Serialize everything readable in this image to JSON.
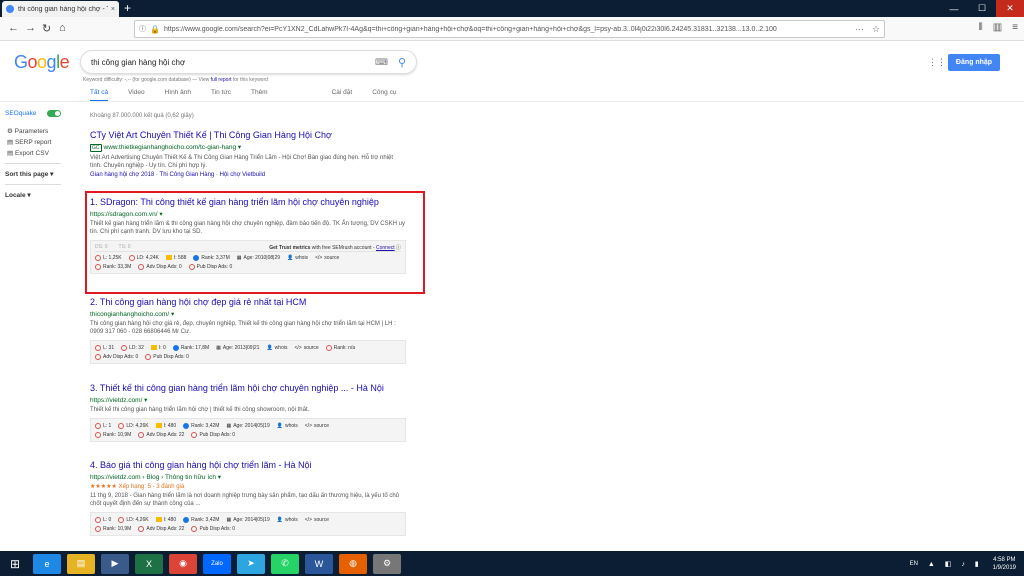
{
  "browser": {
    "tab_title": "thi công gian hàng hội chợ - T",
    "tab_close": "×",
    "new_tab": "+",
    "url": "https://www.google.com/search?ei=PcY1XN2_CdLahwPk7I-4Ag&q=thi+công+gian+hàng+hội+chợ&oq=thi+công+gian+hàng+hội+chợ&gs_l=psy-ab.3..0l4j0i22i30l6.24245.31831..32138...13.0..2.100",
    "win_min": "—",
    "win_max": "☐",
    "win_close": "✕"
  },
  "google": {
    "logo_letters": [
      "G",
      "o",
      "o",
      "g",
      "l",
      "e"
    ],
    "query": "thi công gian hàng hội chợ",
    "signin_label": "Đăng nhập",
    "kw_prefix": "Keyword difficulty: -,-- (for google.com database) — View",
    "kw_link": "full report",
    "kw_suffix": "for this keyword",
    "tabs": [
      "Tất cả",
      "Video",
      "Hình ảnh",
      "Tin tức",
      "Thêm"
    ],
    "tabs_right": [
      "Cài đặt",
      "Công cụ"
    ],
    "stats": "Khoảng 87.000.000 kết quả (0,62 giây)"
  },
  "seoquake": {
    "title": "SEOquake",
    "items": [
      "Parameters",
      "SERP report",
      "Export CSV"
    ],
    "sort_label": "Sort this page",
    "locale_label": "Locale"
  },
  "results": [
    {
      "title": "CTy Việt Art Chuyên Thiết Kế | Thi Công Gian Hàng Hội Chợ",
      "url_badge": "GC",
      "url": "www.thietkegianhanghoicho.com/tc-gian-hang",
      "snippet": "Việt Art Advertising Chuyên Thiết Kế & Thi Công Gian Hàng Triển Lãm - Hội Chợ! Bàn giao đúng hẹn. Hỗ trợ nhiệt tình. Chuyên nghiệp - Uy tín. Chi phí hợp lý.",
      "sitelinks": "Gian hàng hội chợ 2018 · Thi Công Gian Hàng · Hội chợ Vietbuild"
    },
    {
      "title": "1. SDragon: Thi công thiết kế gian hàng triển lãm hội chợ chuyên nghiệp",
      "url": "https://sdragon.com.vn/ ▾",
      "snippet": "Thiết kế gian hàng triển lãm & thi công gian hàng hội chợ chuyên nghiệp, đảm bảo tiến độ. TK Ấn tượng, DV CSKH uy tín. Chi phí cạnh tranh. DV lưu kho tại SD.",
      "trust": {
        "ds": "DS: 0",
        "ts": "TS: 0",
        "text": "Get Trust metrics",
        "text2": "with free SEMrush account -",
        "link": "Connect"
      },
      "row1": [
        [
          "ring",
          "L: 1,25K"
        ],
        [
          "ring",
          "LD: 4,24K"
        ],
        [
          "bar",
          "I: 588"
        ],
        [
          "blue",
          "Rank: 3,37M"
        ],
        [
          "cal",
          "Age: 2010|08|29"
        ],
        [
          "user",
          "whois"
        ],
        [
          "code",
          "source"
        ]
      ],
      "row2": [
        [
          "ring",
          "Rank: 33,3M"
        ],
        [
          "ring",
          "Adv Disp Ads: 0"
        ],
        [
          "ring",
          "Pub Disp Ads: 0"
        ]
      ]
    },
    {
      "title": "2. Thi công gian hàng hội chợ đẹp giá rẻ nhất tại HCM",
      "url": "thicongianhanghoicho.com/ ▾",
      "snippet": "Thi công gian hàng hội chợ giá rẻ, đẹp, chuyên nghiệp, Thiết kế thi công gian hàng hội chợ triển lãm tại HCM | LH : 0909 317 060 - 028 66806446 Mr Cư.",
      "row1": [
        [
          "ring",
          "L: 31"
        ],
        [
          "ring",
          "LD: 32"
        ],
        [
          "bar",
          "I: 0"
        ],
        [
          "blue",
          "Rank: 17,8M"
        ],
        [
          "cal",
          "Age: 2013|09|21"
        ],
        [
          "user",
          "whois"
        ],
        [
          "code",
          "source"
        ],
        [
          "ring",
          "Rank: n/a"
        ]
      ],
      "row2": [
        [
          "ring",
          "Adv Disp Ads: 0"
        ],
        [
          "ring",
          "Pub Disp Ads: 0"
        ]
      ]
    },
    {
      "title": "3. Thiết kế thi công gian hàng triển lãm hội chợ chuyên nghiệp ... - Hà Nội",
      "url": "https://vietdz.com/ ▾",
      "snippet": "Thiết kế thi công gian hàng triển lãm hội chợ | thiết kế thi công showroom, nội thất.",
      "row1": [
        [
          "ring",
          "L: 1"
        ],
        [
          "ring",
          "LD: 4,26K"
        ],
        [
          "bar",
          "I: 480"
        ],
        [
          "blue",
          "Rank: 3,42M"
        ],
        [
          "cal",
          "Age: 2014|05|19"
        ],
        [
          "user",
          "whois"
        ],
        [
          "code",
          "source"
        ]
      ],
      "row2": [
        [
          "ring",
          "Rank: 10,9M"
        ],
        [
          "ring",
          "Adv Disp Ads: 22"
        ],
        [
          "ring",
          "Pub Disp Ads: 0"
        ]
      ]
    },
    {
      "title": "4. Báo giá thi công gian hàng hội chợ triển lãm - Hà Nội",
      "url": "https://vietdz.com › Blog › Thông tin hữu ích ▾",
      "rating": "★★★★★ Xếp hạng: 5 - 3 đánh giá",
      "snippet": "11 thg 9, 2018 - Gian hàng triển lãm là nơi doanh nghiệp trưng bày sản phẩm, tạo dấu ấn thương hiệu, là yếu tố chủ chốt quyết định đến sự thành công của ...",
      "row1": [
        [
          "ring",
          "L: 0"
        ],
        [
          "ring",
          "LD: 4,26K"
        ],
        [
          "bar",
          "I: 480"
        ],
        [
          "blue",
          "Rank: 3,42M"
        ],
        [
          "cal",
          "Age: 2014|05|19"
        ],
        [
          "user",
          "whois"
        ],
        [
          "code",
          "source"
        ]
      ],
      "row2": [
        [
          "ring",
          "Rank: 10,9M"
        ],
        [
          "ring",
          "Adv Disp Ads: 22"
        ],
        [
          "ring",
          "Pub Disp Ads: 0"
        ]
      ]
    }
  ],
  "taskbar": {
    "icons": [
      {
        "name": "ie-icon",
        "glyph": "e",
        "color": "#1e88e5"
      },
      {
        "name": "explorer-icon",
        "glyph": "▤",
        "color": "#e6b422"
      },
      {
        "name": "media-icon",
        "glyph": "▶",
        "color": "#3a5a8a"
      },
      {
        "name": "excel-icon",
        "glyph": "X",
        "color": "#1e7145"
      },
      {
        "name": "chrome-icon",
        "glyph": "◉",
        "color": "#db4437"
      },
      {
        "name": "zalo-icon",
        "glyph": "Zalo",
        "color": "#0068ff"
      },
      {
        "name": "telegram-icon",
        "glyph": "➤",
        "color": "#2ca5e0"
      },
      {
        "name": "whatsapp-icon",
        "glyph": "✆",
        "color": "#25d366"
      },
      {
        "name": "word-icon",
        "glyph": "W",
        "color": "#2b579a"
      },
      {
        "name": "firefox-icon",
        "glyph": "◍",
        "color": "#e66000"
      },
      {
        "name": "settings-icon",
        "glyph": "⚙",
        "color": "#777"
      }
    ],
    "lang": "EN",
    "time": "4:58 PM",
    "date": "1/9/2019"
  }
}
